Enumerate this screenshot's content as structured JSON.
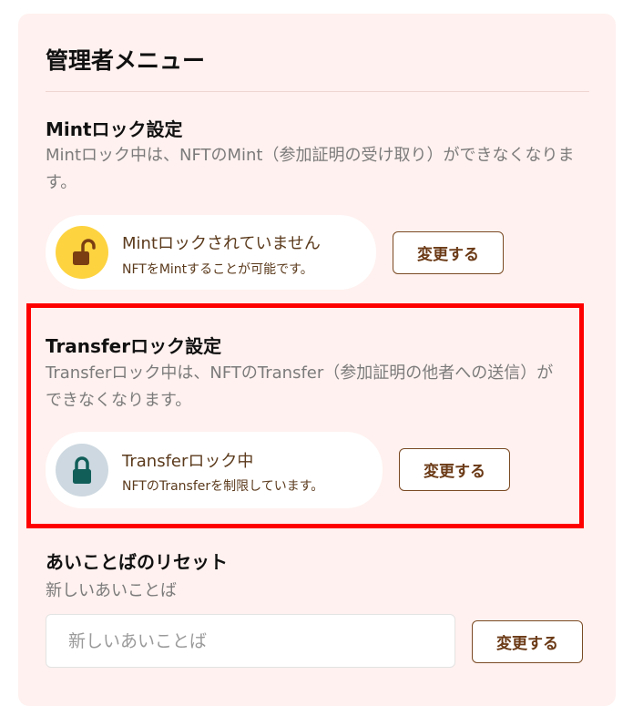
{
  "admin_menu": {
    "title": "管理者メニュー"
  },
  "mint_lock": {
    "heading": "Mintロック設定",
    "description": "Mintロック中は、NFTのMint（参加証明の受け取り）ができなくなります。",
    "status_main": "Mintロックされていません",
    "status_sub": "NFTをMintすることが可能です。",
    "status_icon": "unlock-icon",
    "status_color": "#fdd340",
    "change_label": "変更する"
  },
  "transfer_lock": {
    "heading": "Transferロック設定",
    "description": "Transferロック中は、NFTのTransfer（参加証明の他者への送信）ができなくなります。",
    "status_main": "Transferロック中",
    "status_sub": "NFTのTransferを制限しています。",
    "status_icon": "lock-icon",
    "status_color": "#cdd8e0",
    "change_label": "変更する"
  },
  "passphrase_reset": {
    "heading": "あいことばのリセット",
    "field_label": "新しいあいことば",
    "placeholder": "新しいあいことば",
    "change_label": "変更する"
  }
}
